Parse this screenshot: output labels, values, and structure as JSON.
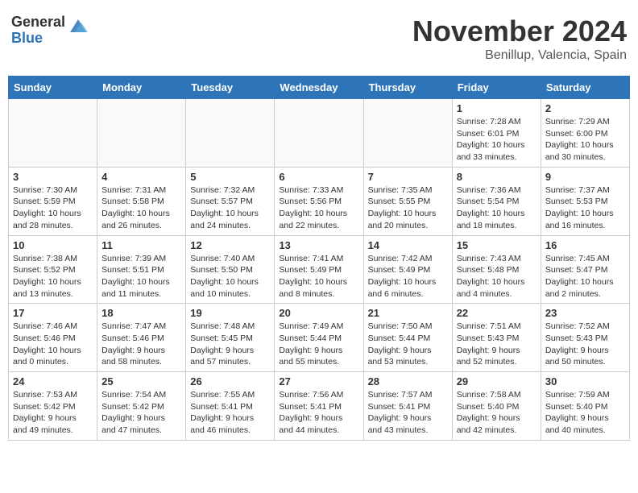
{
  "header": {
    "logo_general": "General",
    "logo_blue": "Blue",
    "month_title": "November 2024",
    "location": "Benillup, Valencia, Spain"
  },
  "weekdays": [
    "Sunday",
    "Monday",
    "Tuesday",
    "Wednesday",
    "Thursday",
    "Friday",
    "Saturday"
  ],
  "weeks": [
    [
      {
        "day": "",
        "info": ""
      },
      {
        "day": "",
        "info": ""
      },
      {
        "day": "",
        "info": ""
      },
      {
        "day": "",
        "info": ""
      },
      {
        "day": "",
        "info": ""
      },
      {
        "day": "1",
        "info": "Sunrise: 7:28 AM\nSunset: 6:01 PM\nDaylight: 10 hours and 33 minutes."
      },
      {
        "day": "2",
        "info": "Sunrise: 7:29 AM\nSunset: 6:00 PM\nDaylight: 10 hours and 30 minutes."
      }
    ],
    [
      {
        "day": "3",
        "info": "Sunrise: 7:30 AM\nSunset: 5:59 PM\nDaylight: 10 hours and 28 minutes."
      },
      {
        "day": "4",
        "info": "Sunrise: 7:31 AM\nSunset: 5:58 PM\nDaylight: 10 hours and 26 minutes."
      },
      {
        "day": "5",
        "info": "Sunrise: 7:32 AM\nSunset: 5:57 PM\nDaylight: 10 hours and 24 minutes."
      },
      {
        "day": "6",
        "info": "Sunrise: 7:33 AM\nSunset: 5:56 PM\nDaylight: 10 hours and 22 minutes."
      },
      {
        "day": "7",
        "info": "Sunrise: 7:35 AM\nSunset: 5:55 PM\nDaylight: 10 hours and 20 minutes."
      },
      {
        "day": "8",
        "info": "Sunrise: 7:36 AM\nSunset: 5:54 PM\nDaylight: 10 hours and 18 minutes."
      },
      {
        "day": "9",
        "info": "Sunrise: 7:37 AM\nSunset: 5:53 PM\nDaylight: 10 hours and 16 minutes."
      }
    ],
    [
      {
        "day": "10",
        "info": "Sunrise: 7:38 AM\nSunset: 5:52 PM\nDaylight: 10 hours and 13 minutes."
      },
      {
        "day": "11",
        "info": "Sunrise: 7:39 AM\nSunset: 5:51 PM\nDaylight: 10 hours and 11 minutes."
      },
      {
        "day": "12",
        "info": "Sunrise: 7:40 AM\nSunset: 5:50 PM\nDaylight: 10 hours and 10 minutes."
      },
      {
        "day": "13",
        "info": "Sunrise: 7:41 AM\nSunset: 5:49 PM\nDaylight: 10 hours and 8 minutes."
      },
      {
        "day": "14",
        "info": "Sunrise: 7:42 AM\nSunset: 5:49 PM\nDaylight: 10 hours and 6 minutes."
      },
      {
        "day": "15",
        "info": "Sunrise: 7:43 AM\nSunset: 5:48 PM\nDaylight: 10 hours and 4 minutes."
      },
      {
        "day": "16",
        "info": "Sunrise: 7:45 AM\nSunset: 5:47 PM\nDaylight: 10 hours and 2 minutes."
      }
    ],
    [
      {
        "day": "17",
        "info": "Sunrise: 7:46 AM\nSunset: 5:46 PM\nDaylight: 10 hours and 0 minutes."
      },
      {
        "day": "18",
        "info": "Sunrise: 7:47 AM\nSunset: 5:46 PM\nDaylight: 9 hours and 58 minutes."
      },
      {
        "day": "19",
        "info": "Sunrise: 7:48 AM\nSunset: 5:45 PM\nDaylight: 9 hours and 57 minutes."
      },
      {
        "day": "20",
        "info": "Sunrise: 7:49 AM\nSunset: 5:44 PM\nDaylight: 9 hours and 55 minutes."
      },
      {
        "day": "21",
        "info": "Sunrise: 7:50 AM\nSunset: 5:44 PM\nDaylight: 9 hours and 53 minutes."
      },
      {
        "day": "22",
        "info": "Sunrise: 7:51 AM\nSunset: 5:43 PM\nDaylight: 9 hours and 52 minutes."
      },
      {
        "day": "23",
        "info": "Sunrise: 7:52 AM\nSunset: 5:43 PM\nDaylight: 9 hours and 50 minutes."
      }
    ],
    [
      {
        "day": "24",
        "info": "Sunrise: 7:53 AM\nSunset: 5:42 PM\nDaylight: 9 hours and 49 minutes."
      },
      {
        "day": "25",
        "info": "Sunrise: 7:54 AM\nSunset: 5:42 PM\nDaylight: 9 hours and 47 minutes."
      },
      {
        "day": "26",
        "info": "Sunrise: 7:55 AM\nSunset: 5:41 PM\nDaylight: 9 hours and 46 minutes."
      },
      {
        "day": "27",
        "info": "Sunrise: 7:56 AM\nSunset: 5:41 PM\nDaylight: 9 hours and 44 minutes."
      },
      {
        "day": "28",
        "info": "Sunrise: 7:57 AM\nSunset: 5:41 PM\nDaylight: 9 hours and 43 minutes."
      },
      {
        "day": "29",
        "info": "Sunrise: 7:58 AM\nSunset: 5:40 PM\nDaylight: 9 hours and 42 minutes."
      },
      {
        "day": "30",
        "info": "Sunrise: 7:59 AM\nSunset: 5:40 PM\nDaylight: 9 hours and 40 minutes."
      }
    ]
  ]
}
